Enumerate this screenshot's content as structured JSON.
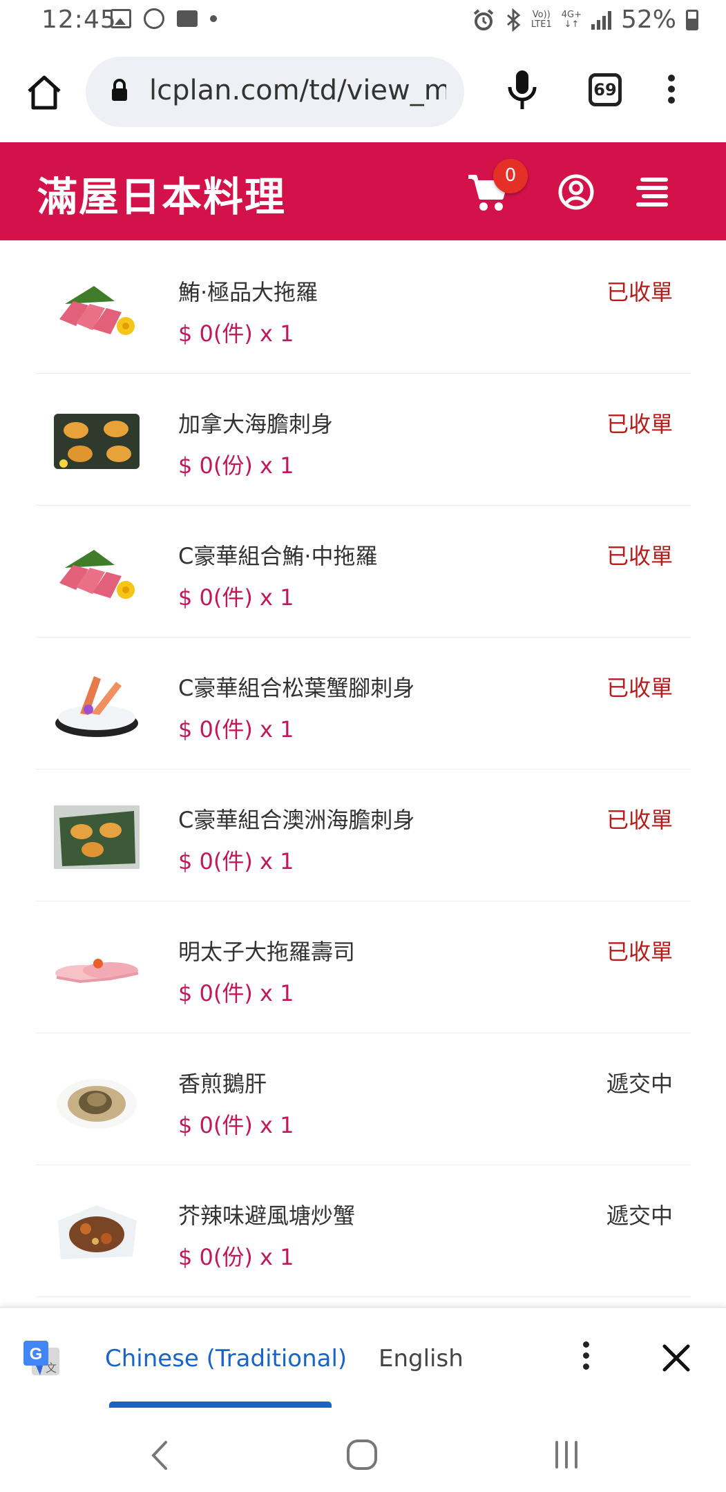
{
  "status_bar": {
    "time": "12:45",
    "network_top": "Vo))",
    "network_bottom": "LTE1",
    "gen_top": "4G+",
    "gen_bottom": "↓↑",
    "battery": "52%"
  },
  "browser": {
    "url": "lcplan.com/td/view_my_tr",
    "tab_count": "69"
  },
  "header": {
    "shop_name": "滿屋日本料理",
    "cart_count": "0",
    "accent_color": "#d3124a"
  },
  "orders": [
    {
      "name": "鮪·極品大拖羅",
      "price": "$ 0(件) x 1",
      "status": "已收單",
      "status_color": "#b71c1c",
      "thumb": "tuna-sashimi"
    },
    {
      "name": "加拿大海膽刺身",
      "price": "$ 0(份) x 1",
      "status": "已收單",
      "status_color": "#b71c1c",
      "thumb": "sea-urchin"
    },
    {
      "name": "C豪華組合鮪·中拖羅",
      "price": "$ 0(件) x 1",
      "status": "已收單",
      "status_color": "#b71c1c",
      "thumb": "tuna-sashimi"
    },
    {
      "name": "C豪華組合松葉蟹腳刺身",
      "price": "$ 0(件) x 1",
      "status": "已收單",
      "status_color": "#b71c1c",
      "thumb": "crab-leg"
    },
    {
      "name": "C豪華組合澳洲海膽刺身",
      "price": "$ 0(件) x 1",
      "status": "已收單",
      "status_color": "#b71c1c",
      "thumb": "sea-urchin-plate"
    },
    {
      "name": "明太子大拖羅壽司",
      "price": "$ 0(件) x 1",
      "status": "已收單",
      "status_color": "#b71c1c",
      "thumb": "sushi"
    },
    {
      "name": "香煎鵝肝",
      "price": "$ 0(件) x 1",
      "status": "遞交中",
      "status_color": "#333333",
      "thumb": "foie-gras"
    },
    {
      "name": "芥辣味避風塘炒蟹",
      "price": "$ 0(份) x 1",
      "status": "遞交中",
      "status_color": "#333333",
      "thumb": "fried-crab"
    }
  ],
  "translate_bar": {
    "source_lang": "Chinese (Traditional)",
    "target_lang": "English"
  }
}
